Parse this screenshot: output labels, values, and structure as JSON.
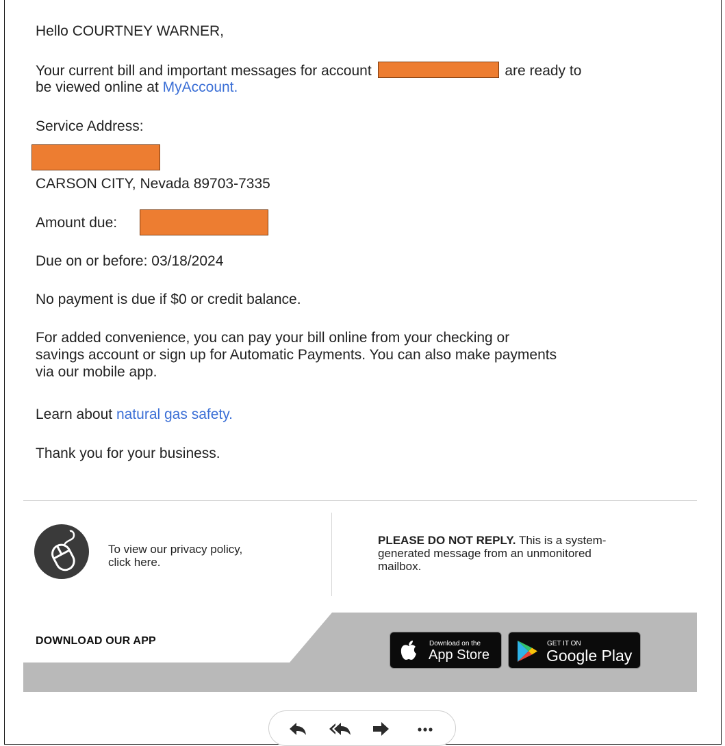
{
  "email": {
    "greeting": "Hello COURTNEY WARNER,",
    "bill_line1_a": "Your current bill and important messages for account",
    "bill_line1_b": "are ready to",
    "bill_line2_a": "be viewed online at",
    "myaccount_link": "MyAccount",
    "bill_line2_end": ".",
    "service_address_label": "Service Address:",
    "address_city": "CARSON CITY, Nevada 89703-7335",
    "amount_due_label": "Amount due:",
    "due_date": "Due on or before: 03/18/2024",
    "no_payment": "No payment is due if $0 or credit balance.",
    "convenience_1": "For added convenience, you can pay your bill online from your checking or",
    "convenience_2": "savings account or sign up for Automatic Payments. You can also make payments",
    "convenience_3": "via our mobile app.",
    "learn_prefix": "Learn about",
    "safety_link": "natural gas safety",
    "learn_end": ".",
    "thanks": "Thank you for your business."
  },
  "footer": {
    "privacy_line1": "To view our privacy policy,",
    "privacy_line2": "click here.",
    "noreply_bold": "PLEASE DO NOT REPLY.",
    "noreply_rest_1": "This is a system-",
    "noreply_rest_2": "generated message from an unmonitored",
    "noreply_rest_3": "mailbox.",
    "download_app": "DOWNLOAD OUR APP",
    "appstore_small": "Download on the",
    "appstore_big": "App Store",
    "gplay_small": "GET IT ON",
    "gplay_big": "Google Play"
  },
  "icons": {
    "privacy": "computer-mouse-icon",
    "apple": "apple-logo-icon",
    "google_play": "google-play-logo-icon",
    "reply": "reply-icon",
    "reply_all": "reply-all-icon",
    "forward": "forward-icon",
    "more": "more-icon"
  },
  "colors": {
    "link": "#3b6fd6",
    "redaction": "#ed7d31",
    "banner": "#b9b9b9",
    "privacy_circle": "#3a3a3a"
  }
}
